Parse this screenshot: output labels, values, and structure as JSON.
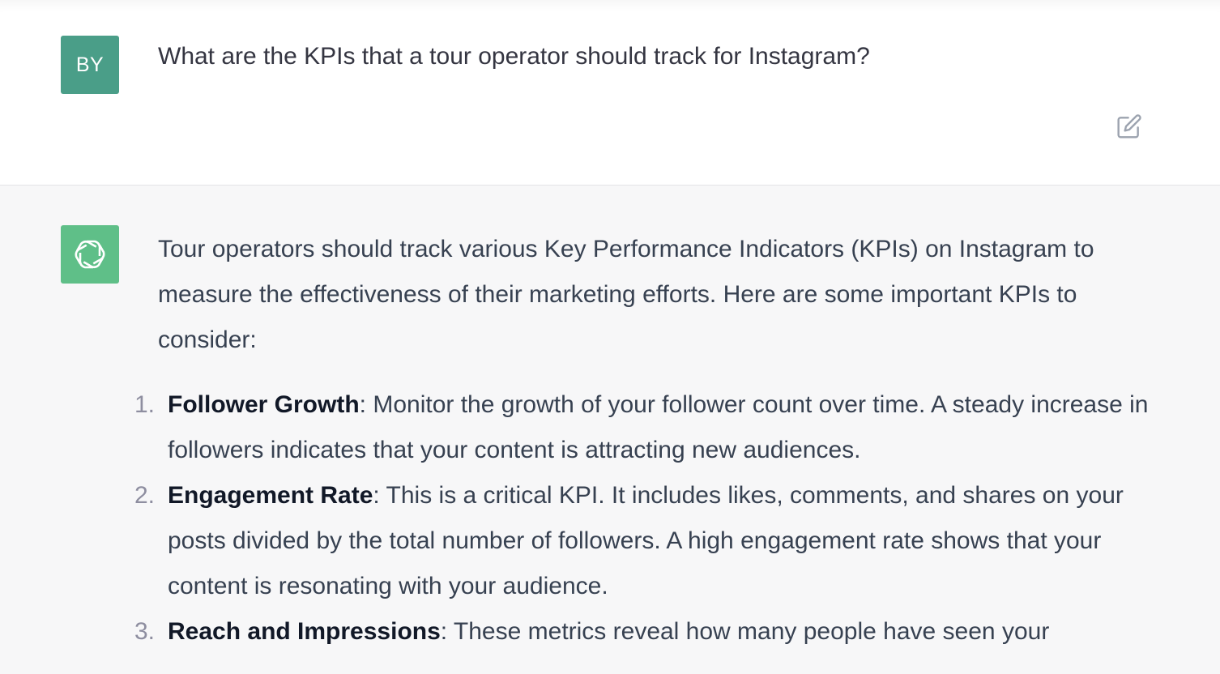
{
  "user_message": {
    "avatar_initials": "BY",
    "avatar_color": "#4a9e88",
    "text": "What are the KPIs that a tour operator should track for Instagram?",
    "edit_icon": "edit-icon"
  },
  "assistant_message": {
    "avatar_icon": "openai-logo-icon",
    "avatar_color": "#5fbf88",
    "intro": "Tour operators should track various Key Performance Indicators (KPIs) on Instagram to measure the effectiveness of their marketing efforts. Here are some important KPIs to consider:",
    "items": [
      {
        "number": "1.",
        "title": "Follower Growth",
        "text": ": Monitor the growth of your follower count over time. A steady increase in followers indicates that your content is attracting new audiences."
      },
      {
        "number": "2.",
        "title": "Engagement Rate",
        "text": ": This is a critical KPI. It includes likes, comments, and shares on your posts divided by the total number of followers. A high engagement rate shows that your content is resonating with your audience."
      },
      {
        "number": "3.",
        "title": "Reach and Impressions",
        "text": ": These metrics reveal how many people have seen your"
      }
    ]
  }
}
